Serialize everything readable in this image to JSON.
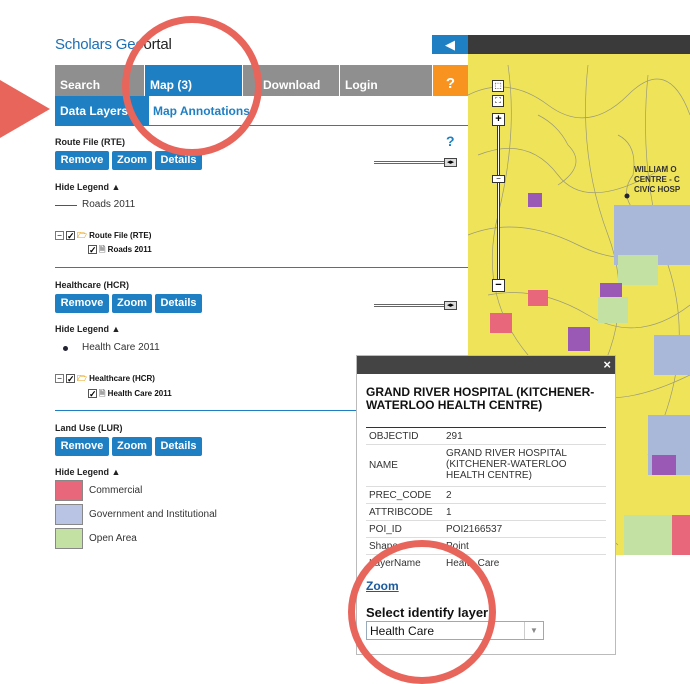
{
  "app": {
    "logo_part1": "Scholars Geo",
    "logo_part2": "ortal"
  },
  "nav": {
    "tabs": [
      {
        "label": "Search"
      },
      {
        "label": "Map (3)"
      },
      {
        "label": "Download"
      },
      {
        "label": "Login"
      },
      {
        "label": "?"
      }
    ]
  },
  "subnav": {
    "data_layers": "Data Layers",
    "map_annotations": "Map Annotations"
  },
  "layers": [
    {
      "title": "Route File (RTE)",
      "buttons": [
        "Remove",
        "Zoom",
        "Details"
      ],
      "help": "?",
      "hide_legend": "Hide Legend",
      "legend": "Roads 2011",
      "tree_parent": "Route File (RTE)",
      "tree_child": "Roads 2011"
    },
    {
      "title": "Healthcare (HCR)",
      "buttons": [
        "Remove",
        "Zoom",
        "Details"
      ],
      "hide_legend": "Hide Legend",
      "legend": "Health Care 2011",
      "tree_parent": "Healthcare (HCR)",
      "tree_child": "Health Care 2011"
    },
    {
      "title": "Land Use (LUR)",
      "buttons": [
        "Remove",
        "Zoom",
        "Details"
      ],
      "hide_legend": "Hide Legend",
      "legend_items": [
        {
          "label": "Commercial",
          "color": "#e8677a"
        },
        {
          "label": "Government and Institutional",
          "color": "#b9c3e4"
        },
        {
          "label": "Open Area",
          "color": "#c4e1a4"
        }
      ]
    }
  ],
  "map_labels": {
    "label1": "WILLIAM O",
    "label2": "CENTRE - C",
    "label3": "CIVIC HOSP"
  },
  "popup": {
    "title": "GRAND RIVER HOSPITAL (KITCHENER-WATERLOO HEALTH CENTRE)",
    "attributes": [
      {
        "key": "OBJECTID",
        "value": "291"
      },
      {
        "key": "NAME",
        "value": "GRAND RIVER HOSPITAL (KITCHENER-WATERLOO HEALTH CENTRE)"
      },
      {
        "key": "PREC_CODE",
        "value": "2"
      },
      {
        "key": "ATTRIBCODE",
        "value": "1"
      },
      {
        "key": "POI_ID",
        "value": "POI2166537"
      },
      {
        "key": "Shape",
        "value": "Point"
      },
      {
        "key": "LayerName",
        "value": "Health Care"
      }
    ],
    "zoom_link": "Zoom",
    "select_label": "Select identify layer",
    "select_value": "Health Care",
    "close": "×"
  },
  "colors": {
    "accent": "#1e7fc3",
    "highlight": "#e8655c",
    "help": "#f7931e",
    "map_bg": "#efe35a"
  },
  "icons": {
    "collapse": "chevron-left-icon",
    "close": "close-icon",
    "folder": "folder-icon",
    "file": "file-icon"
  }
}
